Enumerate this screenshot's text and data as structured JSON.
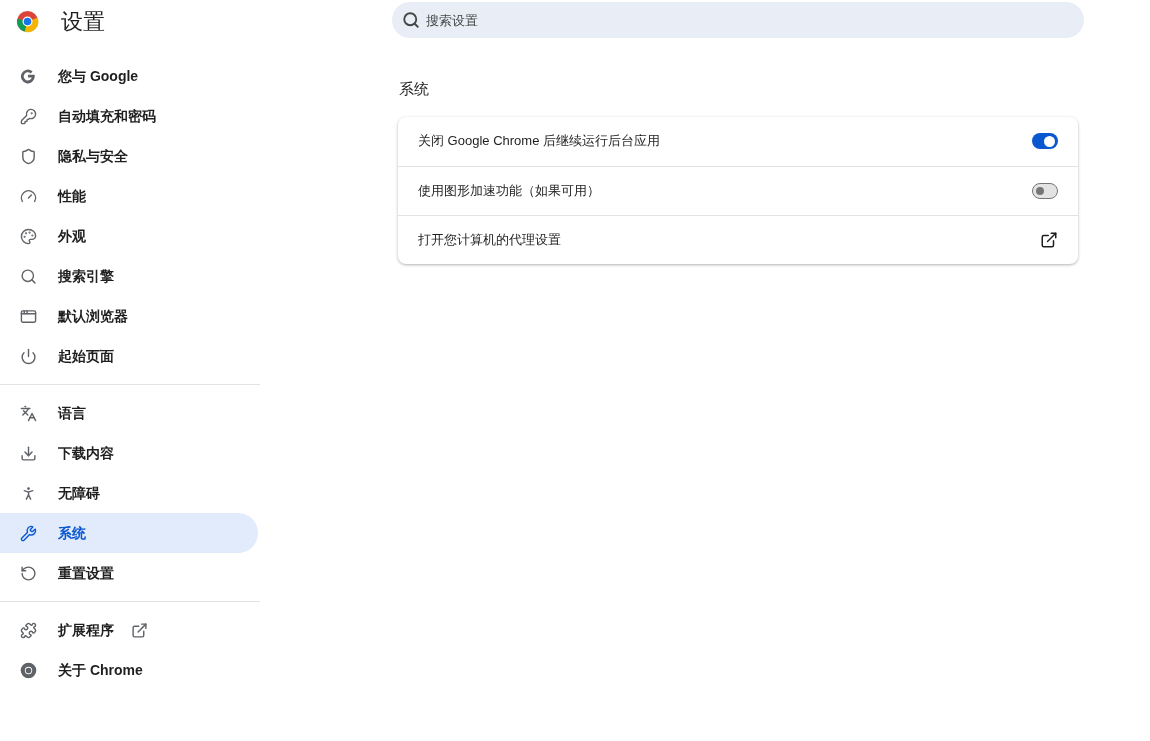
{
  "header": {
    "title": "设置"
  },
  "search": {
    "placeholder": "搜索设置"
  },
  "sidebar": {
    "groups": [
      {
        "items": [
          {
            "label": "您与 Google",
            "selected": false,
            "kind": "page"
          },
          {
            "label": "自动填充和密码",
            "selected": false,
            "kind": "page"
          },
          {
            "label": "隐私与安全",
            "selected": false,
            "kind": "page"
          },
          {
            "label": "性能",
            "selected": false,
            "kind": "page"
          },
          {
            "label": "外观",
            "selected": false,
            "kind": "page"
          },
          {
            "label": "搜索引擎",
            "selected": false,
            "kind": "page"
          },
          {
            "label": "默认浏览器",
            "selected": false,
            "kind": "page"
          },
          {
            "label": "起始页面",
            "selected": false,
            "kind": "page"
          }
        ]
      },
      {
        "items": [
          {
            "label": "语言",
            "selected": false,
            "kind": "page"
          },
          {
            "label": "下载内容",
            "selected": false,
            "kind": "page"
          },
          {
            "label": "无障碍",
            "selected": false,
            "kind": "page"
          },
          {
            "label": "系统",
            "selected": true,
            "kind": "page"
          },
          {
            "label": "重置设置",
            "selected": false,
            "kind": "page"
          }
        ]
      },
      {
        "items": [
          {
            "label": "扩展程序",
            "selected": false,
            "kind": "external"
          },
          {
            "label": "关于 Chrome",
            "selected": false,
            "kind": "page"
          }
        ]
      }
    ]
  },
  "section": {
    "title": "系统",
    "rows": [
      {
        "kind": "toggle",
        "label": "关闭 Google Chrome 后继续运行后台应用",
        "on": true
      },
      {
        "kind": "toggle",
        "label": "使用图形加速功能（如果可用）",
        "on": false
      },
      {
        "kind": "link",
        "label": "打开您计算机的代理设置"
      }
    ]
  }
}
